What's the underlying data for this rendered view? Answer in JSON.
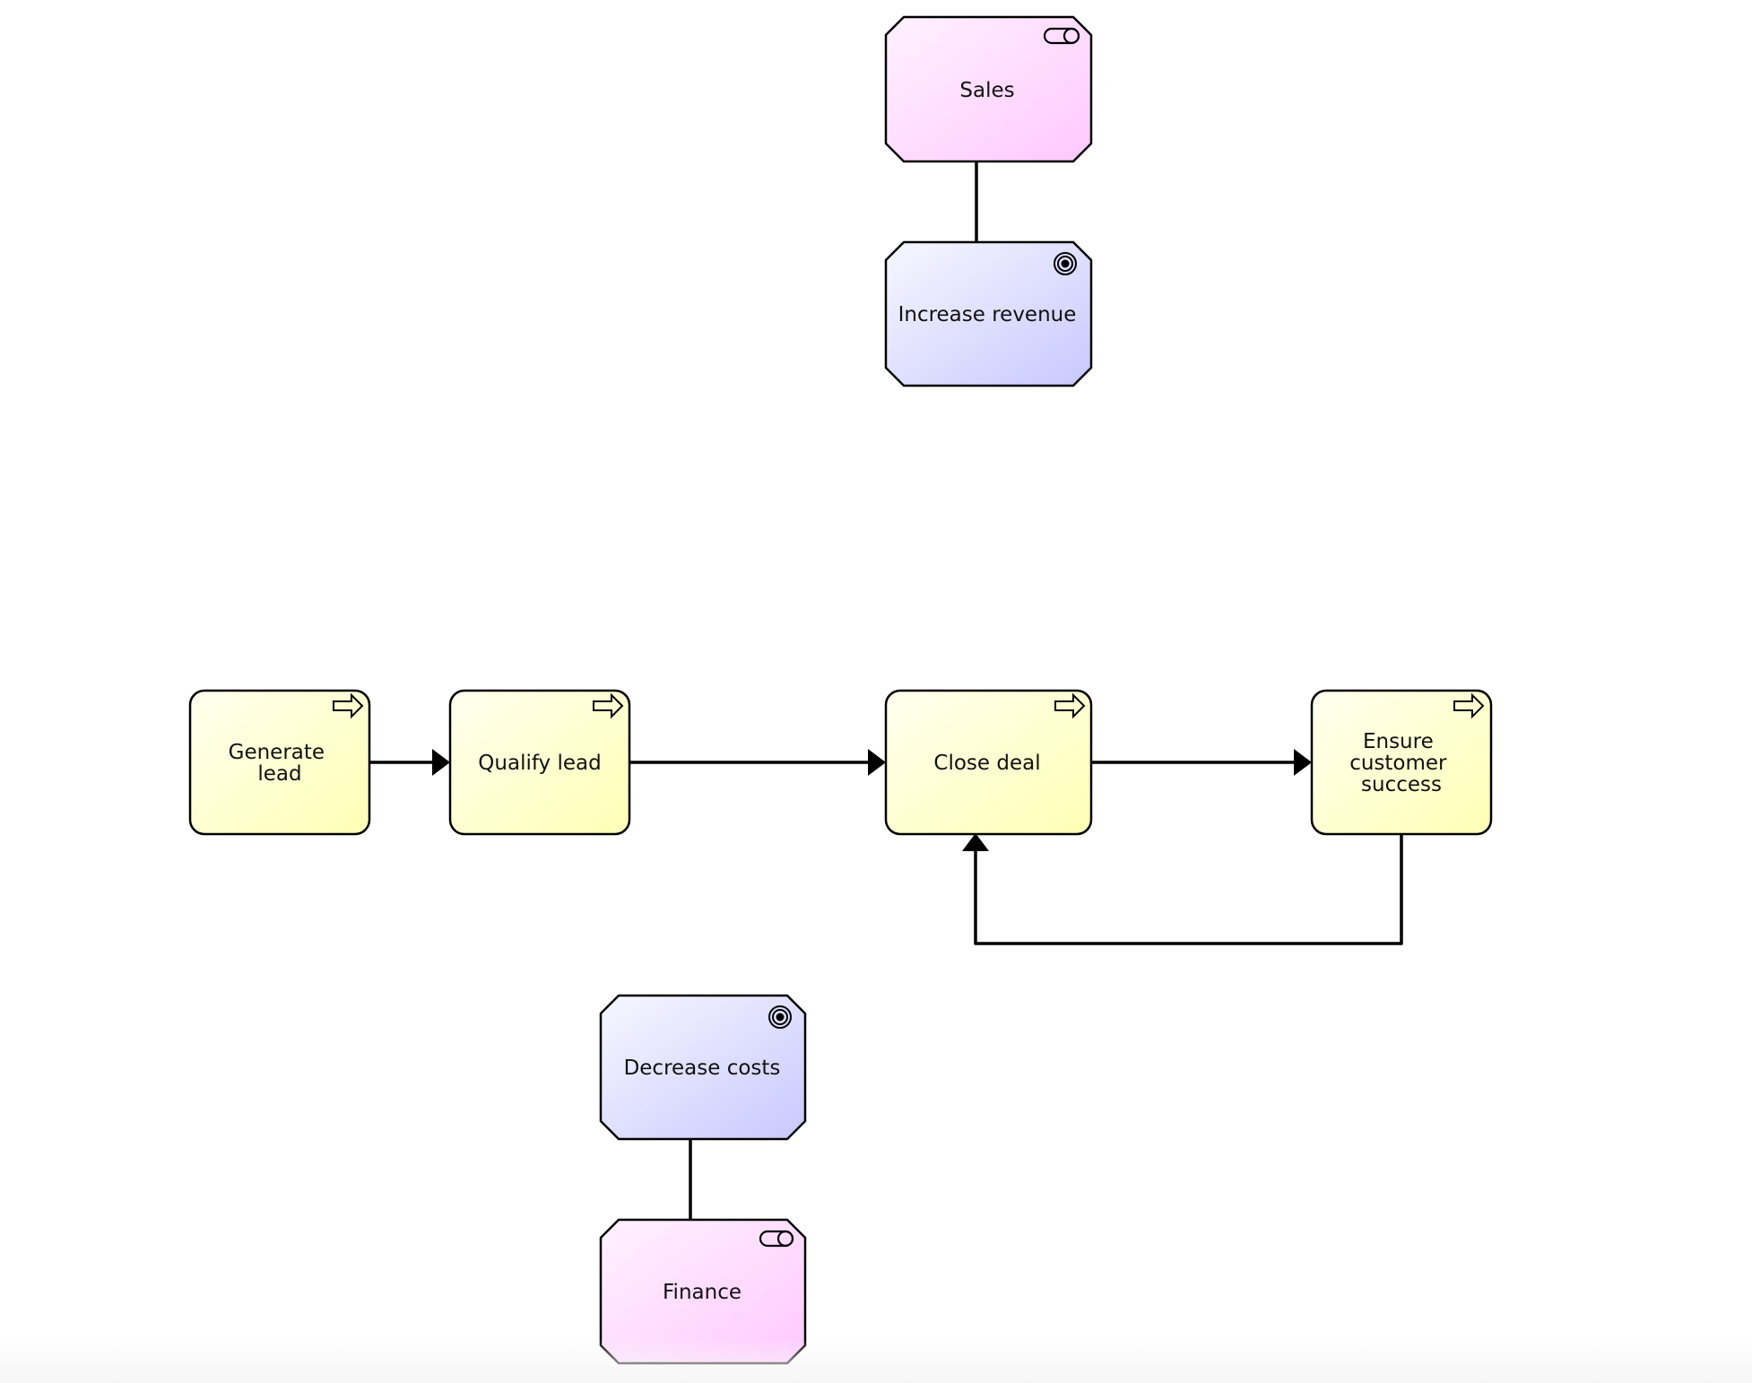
{
  "diagram": {
    "type": "archimate-view",
    "colors": {
      "process_fill_light": "#fffff0",
      "process_fill_dark": "#ffffb5",
      "actor_fill_light": "#fff2ff",
      "actor_fill_dark": "#ffc8ff",
      "goal_fill_light": "#f7f7ff",
      "goal_fill_dark": "#c8c8ff",
      "stroke": "#000000"
    },
    "nodes": [
      {
        "id": "sales",
        "kind": "business-role",
        "icon": "toggle-icon",
        "label_lines": [
          "Sales"
        ]
      },
      {
        "id": "increase-revenue",
        "kind": "goal",
        "icon": "goal-icon",
        "label_lines": [
          "Increase revenue"
        ]
      },
      {
        "id": "generate-lead",
        "kind": "business-process",
        "icon": "process-arrow-icon",
        "label_lines": [
          "Generate",
          "lead"
        ]
      },
      {
        "id": "qualify-lead",
        "kind": "business-process",
        "icon": "process-arrow-icon",
        "label_lines": [
          "Qualify lead"
        ]
      },
      {
        "id": "close-deal",
        "kind": "business-process",
        "icon": "process-arrow-icon",
        "label_lines": [
          "Close deal"
        ]
      },
      {
        "id": "ensure-customer-success",
        "kind": "business-process",
        "icon": "process-arrow-icon",
        "label_lines": [
          "Ensure",
          "customer",
          "success"
        ]
      },
      {
        "id": "decrease-costs",
        "kind": "goal",
        "icon": "goal-icon",
        "label_lines": [
          "Decrease costs"
        ]
      },
      {
        "id": "finance",
        "kind": "business-role",
        "icon": "toggle-icon",
        "label_lines": [
          "Finance"
        ]
      }
    ],
    "edges": [
      {
        "from": "sales",
        "to": "increase-revenue",
        "kind": "association",
        "arrow": false
      },
      {
        "from": "generate-lead",
        "to": "qualify-lead",
        "kind": "triggering",
        "arrow": true
      },
      {
        "from": "qualify-lead",
        "to": "close-deal",
        "kind": "triggering",
        "arrow": true
      },
      {
        "from": "close-deal",
        "to": "ensure-customer-success",
        "kind": "triggering",
        "arrow": true
      },
      {
        "from": "ensure-customer-success",
        "to": "close-deal",
        "kind": "triggering",
        "arrow": true
      },
      {
        "from": "decrease-costs",
        "to": "finance",
        "kind": "association",
        "arrow": false
      }
    ]
  }
}
